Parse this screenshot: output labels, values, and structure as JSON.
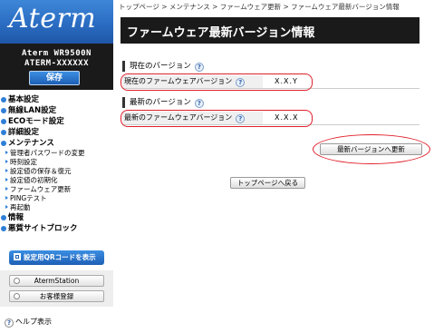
{
  "sidebar": {
    "logo": "Aterm",
    "model_line1": "Aterm WR9500N",
    "model_line2": "ATERM-XXXXXX",
    "save_label": "保存",
    "nav": [
      {
        "label": "基本設定"
      },
      {
        "label": "無線LAN設定"
      },
      {
        "label": "ECOモード設定"
      },
      {
        "label": "詳細設定"
      },
      {
        "label": "メンテナンス",
        "sub": [
          "管理者パスワードの変更",
          "時刻設定",
          "設定値の保存＆復元",
          "設定値の初期化",
          "ファームウェア更新",
          "PINGテスト",
          "再起動"
        ]
      },
      {
        "label": "情報"
      },
      {
        "label": "悪質サイトブロック"
      }
    ],
    "qr_label": "設定用QRコードを表示",
    "atermstation_label": "AtermStation",
    "register_label": "お客様登録",
    "help_label": "ヘルプ表示",
    "help_icon": "?"
  },
  "main": {
    "breadcrumb": "トップページ > メンテナンス > ファームウェア更新 > ファームウェア最新バージョン情報",
    "title": "ファームウェア最新バージョン情報",
    "current_section": "現在のバージョン",
    "current_label": "現在のファームウェアバージョン",
    "current_value": "X.X.Y",
    "latest_section": "最新のバージョン",
    "latest_label": "最新のファームウェアバージョン",
    "latest_value": "X.X.X",
    "help_icon": "?",
    "update_button": "最新バージョンへ更新",
    "top_page_button": "トップページへ戻る"
  },
  "colors": {
    "accent_blue": "#2a6cc2",
    "title_bar": "#1a1a1a",
    "highlight_red": "#e0202a"
  }
}
